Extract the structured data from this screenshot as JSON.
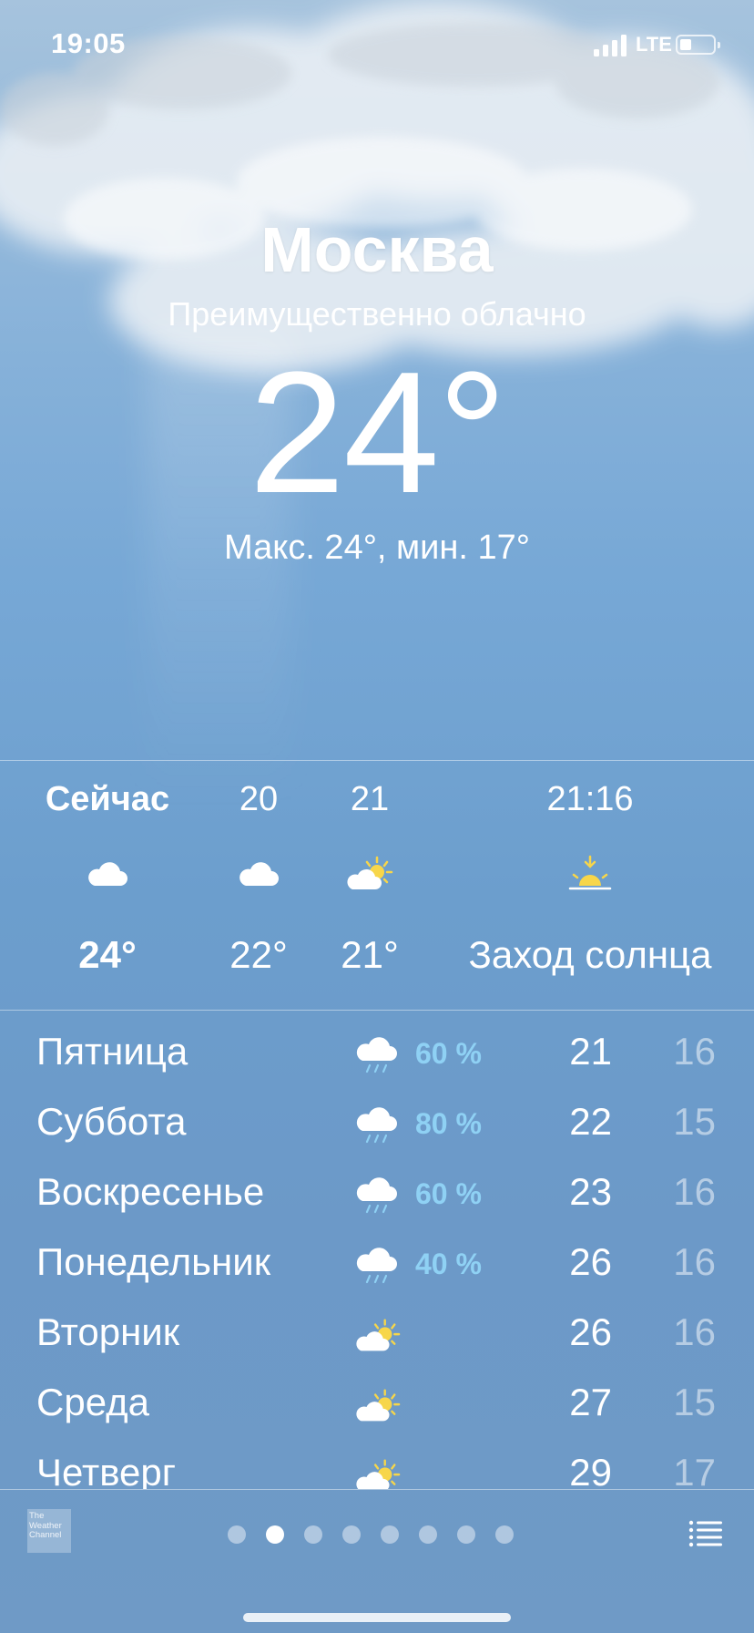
{
  "status_bar": {
    "time": "19:05",
    "network": "LTE"
  },
  "location": {
    "city": "Москва",
    "condition": "Преимущественно облачно",
    "temperature": "24°",
    "high_low": "Макс. 24°, мин. 17°"
  },
  "hourly": [
    {
      "label": "Сейчас",
      "icon": "cloud-icon",
      "value": "24°"
    },
    {
      "label": "20",
      "icon": "cloud-icon",
      "value": "22°"
    },
    {
      "label": "21",
      "icon": "partly-sunny-icon",
      "value": "21°"
    },
    {
      "label": "21:16",
      "icon": "sunset-icon",
      "value": "Заход солнца"
    }
  ],
  "daily": [
    {
      "day": "Пятница",
      "icon": "rain-icon",
      "precip": "60 %",
      "high": "21",
      "low": "16"
    },
    {
      "day": "Суббота",
      "icon": "rain-icon",
      "precip": "80 %",
      "high": "22",
      "low": "15"
    },
    {
      "day": "Воскресенье",
      "icon": "rain-icon",
      "precip": "60 %",
      "high": "23",
      "low": "16"
    },
    {
      "day": "Понедельник",
      "icon": "rain-icon",
      "precip": "40 %",
      "high": "26",
      "low": "16"
    },
    {
      "day": "Вторник",
      "icon": "partly-sunny-icon",
      "precip": "",
      "high": "26",
      "low": "16"
    },
    {
      "day": "Среда",
      "icon": "partly-sunny-icon",
      "precip": "",
      "high": "27",
      "low": "15"
    },
    {
      "day": "Четверг",
      "icon": "partly-sunny-icon",
      "precip": "",
      "high": "29",
      "low": "17"
    }
  ],
  "bottom_bar": {
    "provider_logo_lines": [
      "The",
      "Weather",
      "Channel"
    ],
    "page_count": 8,
    "active_page": 2
  },
  "colors": {
    "precip_text": "#8fd1f4",
    "sun_yellow": "#f7d64a",
    "background_blue": "#6c9ecd"
  }
}
